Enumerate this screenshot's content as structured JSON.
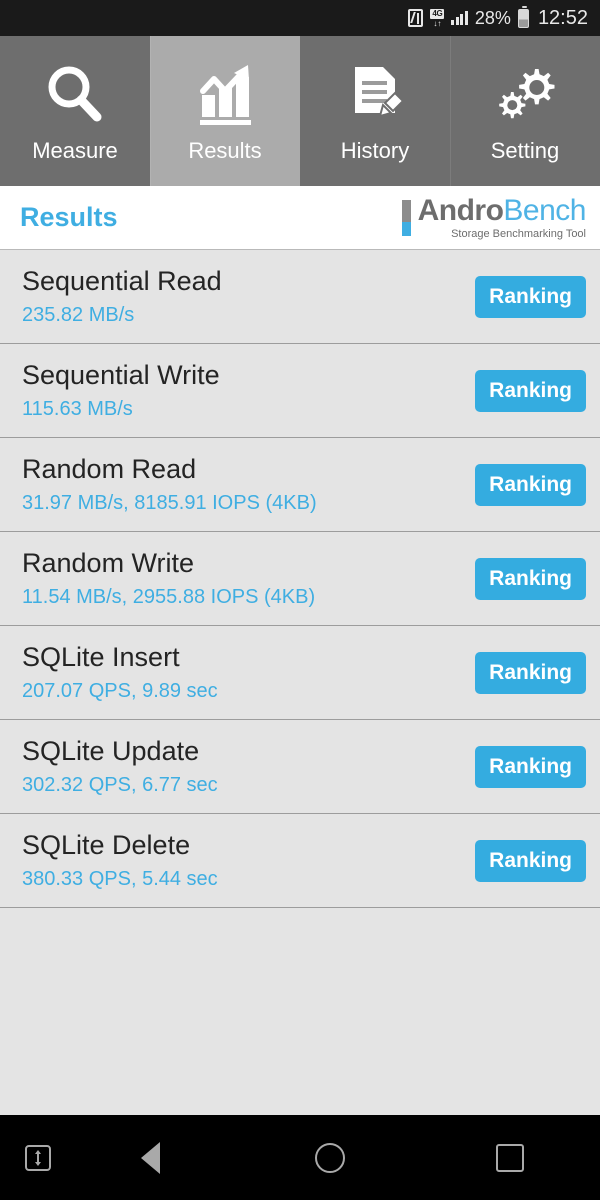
{
  "statusbar": {
    "nfc_icon": "nfc-icon",
    "network_label": "4G",
    "network_arrows": "↓↑",
    "signal_icon": "signal-bars-icon",
    "battery_percent": "28%",
    "battery_icon": "battery-icon",
    "time": "12:52"
  },
  "tabs": [
    {
      "label": "Measure",
      "icon": "magnifier-icon",
      "selected": false
    },
    {
      "label": "Results",
      "icon": "bar-chart-icon",
      "selected": true
    },
    {
      "label": "History",
      "icon": "document-pencil-icon",
      "selected": false
    },
    {
      "label": "Setting",
      "icon": "gears-icon",
      "selected": false
    }
  ],
  "header": {
    "title": "Results",
    "logo_primary": "Andro",
    "logo_secondary": "Bench",
    "logo_tagline": "Storage Benchmarking Tool"
  },
  "results": {
    "button_label": "Ranking",
    "rows": [
      {
        "title": "Sequential Read",
        "value": "235.82 MB/s"
      },
      {
        "title": "Sequential Write",
        "value": "115.63 MB/s"
      },
      {
        "title": "Random Read",
        "value": "31.97 MB/s, 8185.91 IOPS (4KB)"
      },
      {
        "title": "Random Write",
        "value": "11.54 MB/s, 2955.88 IOPS (4KB)"
      },
      {
        "title": "SQLite Insert",
        "value": "207.07 QPS, 9.89 sec"
      },
      {
        "title": "SQLite Update",
        "value": "302.32 QPS, 6.77 sec"
      },
      {
        "title": "SQLite Delete",
        "value": "380.33 QPS, 5.44 sec"
      }
    ]
  },
  "navbar": {
    "hide_icon": "hide-navbar-icon",
    "back_icon": "back-triangle-icon",
    "home_icon": "home-circle-icon",
    "recents_icon": "recents-square-icon"
  },
  "colors": {
    "accent_blue": "#3FAEE2",
    "button_blue": "#34ACE0",
    "tab_bg": "#6E6E6E",
    "tab_selected_bg": "#ABABAB",
    "list_bg": "#E4E4E4",
    "divider": "#9C9C9C",
    "title_text": "#242424"
  }
}
